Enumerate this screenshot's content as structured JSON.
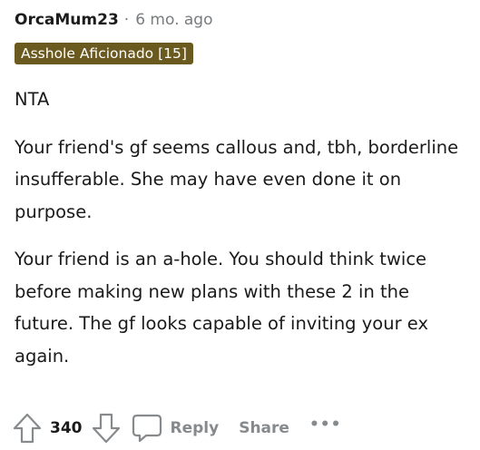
{
  "comment": {
    "author": "OrcaMum23",
    "separator": "·",
    "timestamp": "6 mo. ago",
    "flair": "Asshole Aficionado [15]",
    "flair_color": "#6b5a1f",
    "paragraphs": [
      "NTA",
      "Your friend's gf seems callous and, tbh, borderline insufferable. She may have even done it on purpose.",
      "Your friend is an a-hole. You should think twice before making new plans with these 2 in the future. The gf looks capable of inviting your ex again."
    ]
  },
  "actions": {
    "upvote_icon": "arrow-up-icon",
    "score": "340",
    "downvote_icon": "arrow-down-icon",
    "reply_icon": "speech-bubble-icon",
    "reply_label": "Reply",
    "share_label": "Share",
    "more_label": "•••"
  }
}
